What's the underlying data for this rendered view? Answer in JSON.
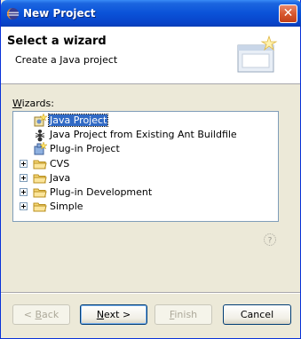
{
  "window": {
    "title": "New Project"
  },
  "header": {
    "title": "Select a wizard",
    "subtitle": "Create a Java project"
  },
  "wizards_label": {
    "mnemonic": "W",
    "rest": "izards:"
  },
  "tree": {
    "items": [
      {
        "label": "Java Project",
        "icon": "java-project-icon",
        "selected": true,
        "expandable": false
      },
      {
        "label": "Java Project from Existing Ant Buildfile",
        "icon": "ant-icon",
        "selected": false,
        "expandable": false
      },
      {
        "label": "Plug-in Project",
        "icon": "plugin-project-icon",
        "selected": false,
        "expandable": false
      },
      {
        "label": "CVS",
        "icon": "folder-icon",
        "selected": false,
        "expandable": true
      },
      {
        "label": "Java",
        "icon": "folder-icon",
        "selected": false,
        "expandable": true
      },
      {
        "label": "Plug-in Development",
        "icon": "folder-icon",
        "selected": false,
        "expandable": true
      },
      {
        "label": "Simple",
        "icon": "folder-icon",
        "selected": false,
        "expandable": true
      }
    ]
  },
  "buttons": {
    "back": {
      "prefix": "< ",
      "mnemonic": "B",
      "rest": "ack"
    },
    "next": {
      "mnemonic": "N",
      "rest": "ext >"
    },
    "finish": {
      "mnemonic": "F",
      "rest": "inish"
    },
    "cancel": {
      "label": "Cancel"
    }
  },
  "colors": {
    "title_bar": "#0a52d8",
    "selection": "#316ac5",
    "dialog_bg": "#ece9d8"
  }
}
